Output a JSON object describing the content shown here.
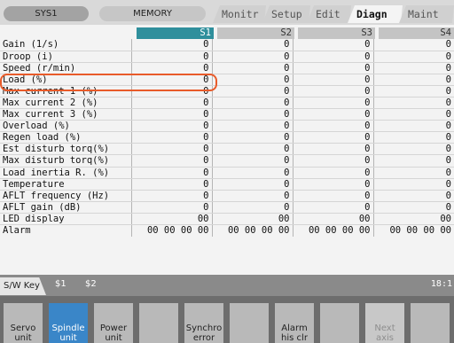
{
  "topbar": {
    "system": "SYS1",
    "mode": "MEMORY",
    "tabs": [
      "Monitr",
      "Setup",
      "Edit",
      "Diagn",
      "Maint"
    ],
    "active_tab": "Diagn"
  },
  "columns": [
    "S1",
    "S2",
    "S3",
    "S4"
  ],
  "rows": [
    {
      "label": "Gain (1/s)",
      "values": [
        "0",
        "0",
        "0",
        "0"
      ]
    },
    {
      "label": "Droop (i)",
      "values": [
        "0",
        "0",
        "0",
        "0"
      ]
    },
    {
      "label": "Speed (r/min)",
      "values": [
        "0",
        "0",
        "0",
        "0"
      ]
    },
    {
      "label": "Load (%)",
      "values": [
        "0",
        "0",
        "0",
        "0"
      ]
    },
    {
      "label": "Max current 1 (%)",
      "values": [
        "0",
        "0",
        "0",
        "0"
      ]
    },
    {
      "label": "Max current 2 (%)",
      "values": [
        "0",
        "0",
        "0",
        "0"
      ]
    },
    {
      "label": "Max current 3 (%)",
      "values": [
        "0",
        "0",
        "0",
        "0"
      ]
    },
    {
      "label": "Overload (%)",
      "values": [
        "0",
        "0",
        "0",
        "0"
      ]
    },
    {
      "label": "Regen load (%)",
      "values": [
        "0",
        "0",
        "0",
        "0"
      ]
    },
    {
      "label": "Est disturb torq(%)",
      "values": [
        "0",
        "0",
        "0",
        "0"
      ]
    },
    {
      "label": "Max disturb torq(%)",
      "values": [
        "0",
        "0",
        "0",
        "0"
      ]
    },
    {
      "label": "Load inertia R. (%)",
      "values": [
        "0",
        "0",
        "0",
        "0"
      ]
    },
    {
      "label": "Temperature",
      "values": [
        "0",
        "0",
        "0",
        "0"
      ]
    },
    {
      "label": "AFLT frequency (Hz)",
      "values": [
        "0",
        "0",
        "0",
        "0"
      ]
    },
    {
      "label": "AFLT gain     (dB)",
      "values": [
        "0",
        "0",
        "0",
        "0"
      ]
    },
    {
      "label": "LED display",
      "values": [
        "00",
        "00",
        "00",
        "00"
      ]
    },
    {
      "label": "Alarm",
      "values": [
        "00 00 00 00",
        "00 00 00 00",
        "00 00 00 00",
        "00 00 00 00"
      ]
    }
  ],
  "swbar": {
    "label": "S/W Key",
    "status_1": "$1",
    "status_1_state": "   ",
    "status_2": "$2",
    "status_2_state": "   ",
    "clock": "18:1"
  },
  "softkeys": [
    {
      "label": "Servo unit",
      "state": "normal"
    },
    {
      "label": "Spindle unit",
      "state": "active"
    },
    {
      "label": "Power unit",
      "state": "normal"
    },
    {
      "label": "",
      "state": "normal"
    },
    {
      "label": "Synchro error",
      "state": "normal"
    },
    {
      "label": "",
      "state": "normal"
    },
    {
      "label": "Alarm his clr",
      "state": "normal"
    },
    {
      "label": "",
      "state": "normal"
    },
    {
      "label": "Next axis",
      "state": "disabled"
    },
    {
      "label": "",
      "state": "normal"
    }
  ],
  "colors": {
    "active_column": "#2f8f9c",
    "highlight": "#e85b2a",
    "active_key": "#3a86c8"
  }
}
